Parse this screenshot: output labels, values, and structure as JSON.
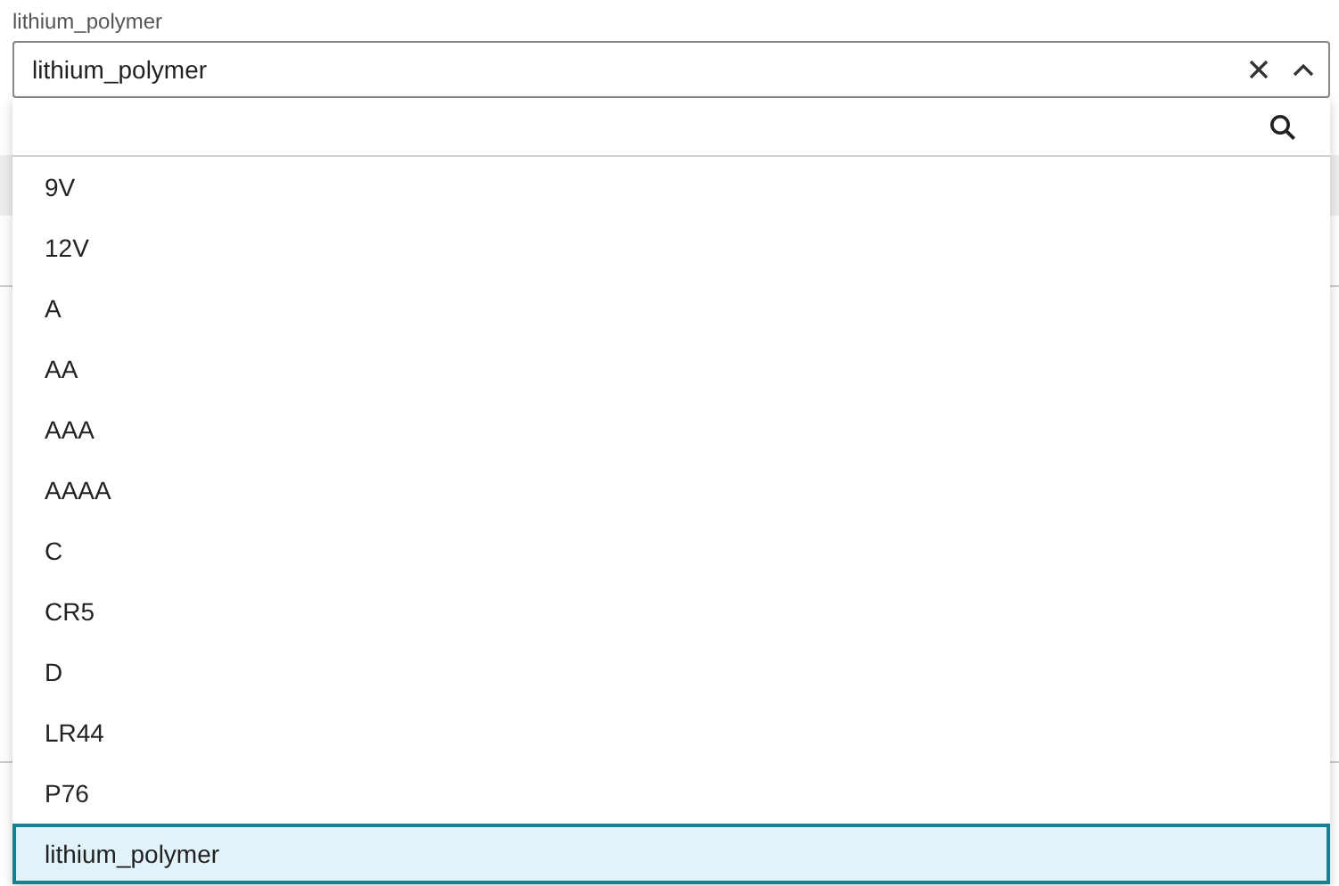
{
  "field": {
    "label": "lithium_polymer",
    "value": "lithium_polymer",
    "expanded": true
  },
  "options": [
    {
      "label": "9V",
      "selected": false
    },
    {
      "label": "12V",
      "selected": false
    },
    {
      "label": "A",
      "selected": false
    },
    {
      "label": "AA",
      "selected": false
    },
    {
      "label": "AAA",
      "selected": false
    },
    {
      "label": "AAAA",
      "selected": false
    },
    {
      "label": "C",
      "selected": false
    },
    {
      "label": "CR5",
      "selected": false
    },
    {
      "label": "D",
      "selected": false
    },
    {
      "label": "LR44",
      "selected": false
    },
    {
      "label": "P76",
      "selected": false
    },
    {
      "label": "lithium_polymer",
      "selected": true
    }
  ]
}
